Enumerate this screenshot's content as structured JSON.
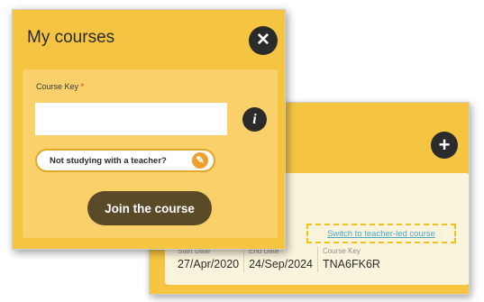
{
  "modal": {
    "title": "My courses",
    "close_icon": "close-icon",
    "course_key_label": "Course Key",
    "required_marker": "*",
    "course_key_value": "",
    "info_icon": "info-icon",
    "info_glyph": "i",
    "no_teacher_label": "Not studying with a teacher?",
    "wrench_icon": "wrench-icon",
    "join_label": "Join the course"
  },
  "course_panel": {
    "add_icon": "plus-icon",
    "switch_link_label": "Switch to teacher-led course",
    "start_date_label": "Start Date",
    "start_date": "27/Apr/2020",
    "end_date_label": "End Date",
    "end_date": "24/Sep/2024",
    "course_key_label": "Course Key",
    "course_key": "TNA6FK6R"
  },
  "colors": {
    "panel_background": "#f5c542",
    "card_background": "#f9d06a",
    "join_button": "#5b4a28",
    "link": "#4aa8c5",
    "highlight_border": "#f2c21c",
    "required": "#d9342b"
  }
}
